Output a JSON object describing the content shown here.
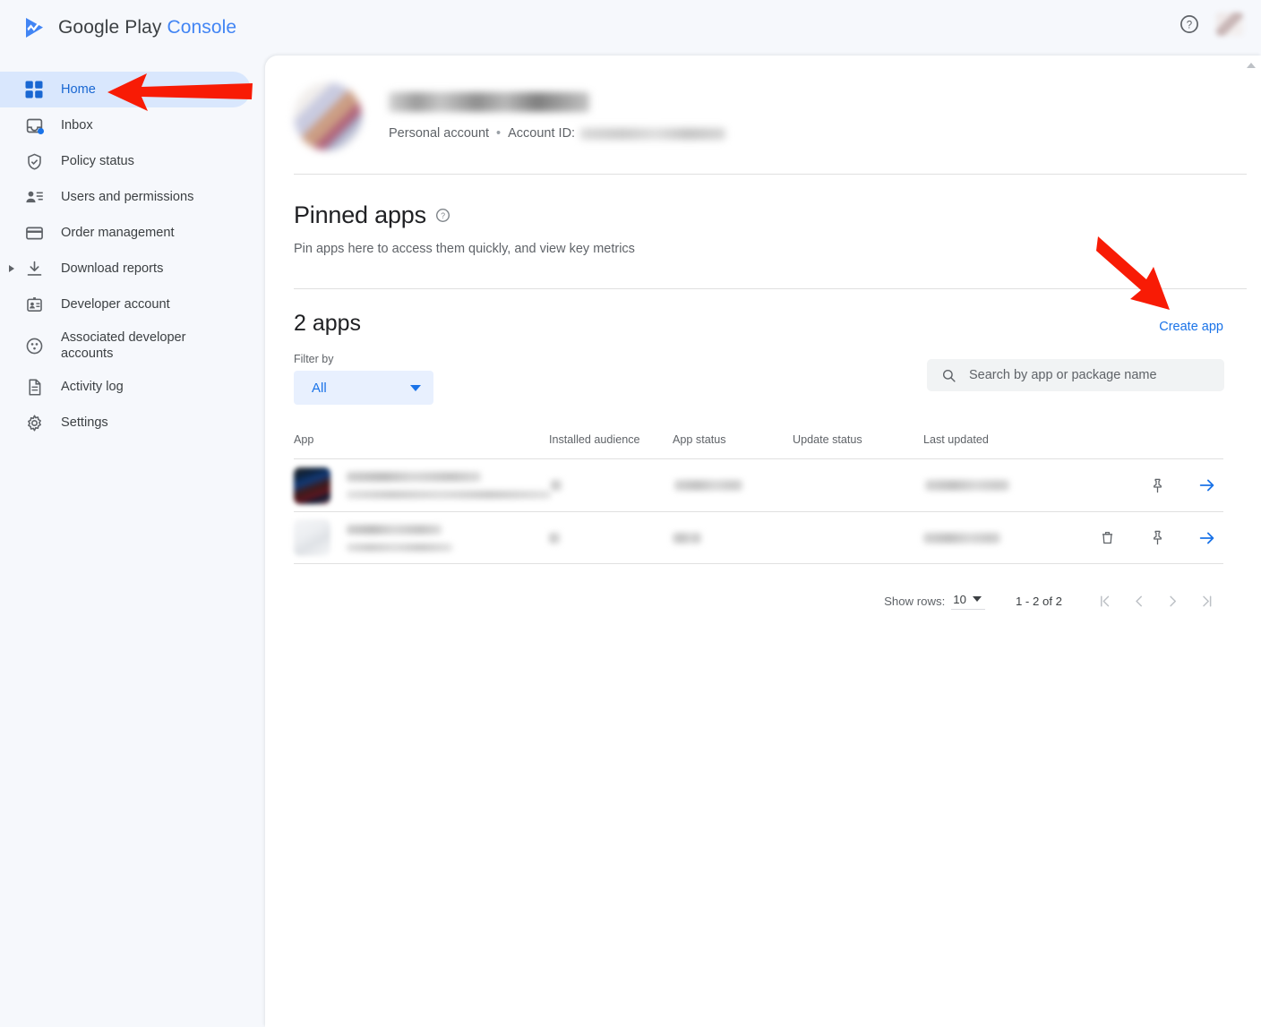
{
  "app": {
    "brand_primary": "Google Play ",
    "brand_accent": "Console",
    "accent_color": "#4285f4",
    "link_color": "#1a73e8"
  },
  "topbar": {
    "help_icon": "help-circle-icon",
    "avatar": "user-avatar"
  },
  "sidebar": {
    "items": [
      {
        "label": "Home",
        "icon": "grid-icon",
        "active": true
      },
      {
        "label": "Inbox",
        "icon": "inbox-icon",
        "badge_dot": true
      },
      {
        "label": "Policy status",
        "icon": "shield-check-icon"
      },
      {
        "label": "Users and permissions",
        "icon": "person-list-icon"
      },
      {
        "label": "Order management",
        "icon": "credit-card-icon"
      },
      {
        "label": "Download reports",
        "icon": "download-icon",
        "expandable": true
      },
      {
        "label": "Developer account",
        "icon": "id-badge-icon"
      },
      {
        "label": "Associated developer accounts",
        "icon": "accounts-circle-icon"
      },
      {
        "label": "Activity log",
        "icon": "document-lines-icon"
      },
      {
        "label": "Settings",
        "icon": "gear-icon"
      }
    ]
  },
  "account": {
    "name_redacted": "",
    "type": "Personal account",
    "separator": "•",
    "account_id_label": "Account ID:",
    "account_id_redacted": ""
  },
  "pinned": {
    "title": "Pinned apps",
    "help_icon": "help-circle-icon",
    "description": "Pin apps here to access them quickly, and view key metrics"
  },
  "apps": {
    "count_label": "2 apps",
    "create_app_label": "Create app",
    "filter_label": "Filter by",
    "filter_value": "All",
    "search_placeholder": "Search by app or package name",
    "columns": [
      "App",
      "Installed audience",
      "App status",
      "Update status",
      "Last updated"
    ],
    "rows": [
      {
        "name_redacted": "",
        "package_redacted": "",
        "installed_audience_redacted": "",
        "app_status_redacted": "",
        "update_status_redacted": "",
        "last_updated_redacted": "",
        "icon_style": "dark",
        "actions": [
          "pin-icon",
          "open-arrow-icon"
        ]
      },
      {
        "name_redacted": "",
        "package_redacted": "",
        "installed_audience_redacted": "",
        "app_status_redacted": "",
        "update_status_redacted": "",
        "last_updated_redacted": "",
        "icon_style": "light",
        "actions": [
          "delete-icon",
          "pin-icon",
          "open-arrow-icon"
        ]
      }
    ]
  },
  "pagination": {
    "rows_label": "Show rows:",
    "rows_value": "10",
    "range": "1 - 2 of 2",
    "first_icon": "first-page-icon",
    "prev_icon": "previous-page-icon",
    "next_icon": "next-page-icon",
    "last_icon": "last-page-icon"
  },
  "annotations": {
    "arrow_color": "#f81b05",
    "arrows": [
      {
        "name": "arrow-pointing-home",
        "target": "Home"
      },
      {
        "name": "arrow-pointing-create-app",
        "target": "Create app"
      }
    ]
  }
}
